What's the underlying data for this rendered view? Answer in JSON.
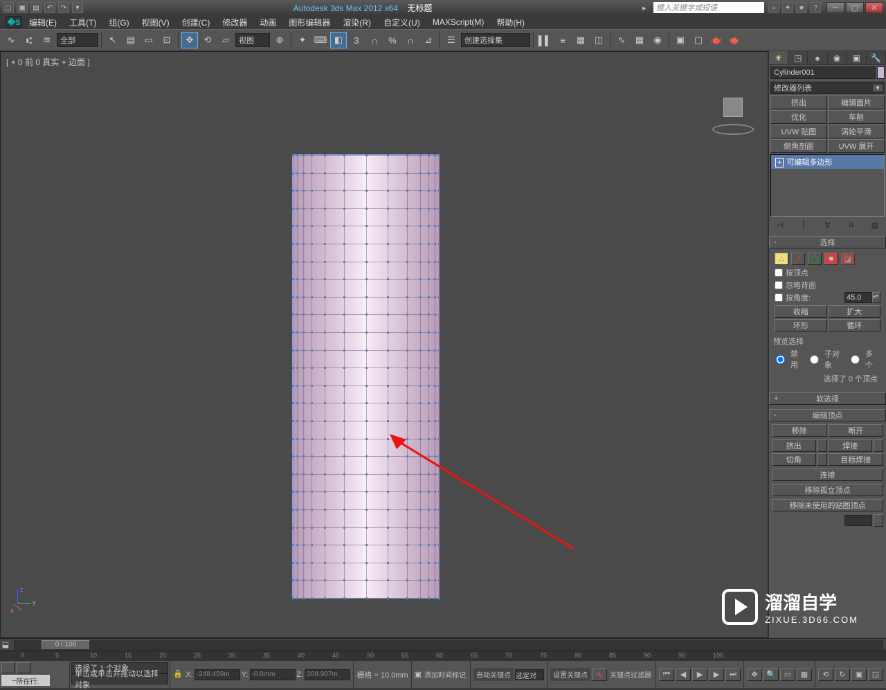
{
  "title": {
    "app": "Autodesk 3ds Max  2012 x64",
    "doc": "无标题"
  },
  "search_placeholder": "键入关键字或短语",
  "menu": [
    "编辑(E)",
    "工具(T)",
    "组(G)",
    "视图(V)",
    "创建(C)",
    "修改器",
    "动画",
    "图形编辑器",
    "渲染(R)",
    "自定义(U)",
    "MAXScript(M)",
    "帮助(H)"
  ],
  "toolbar": {
    "filter": "全部",
    "view": "视图",
    "angle": "3",
    "selset": "创建选择集"
  },
  "viewport_label": "[ + 0 前 0 真实 + 边面  ]",
  "sidepanel": {
    "obj_name": "Cylinder001",
    "modlist": "修改器列表",
    "modbtns": [
      "挤出",
      "编辑面片",
      "优化",
      "车削",
      "UVW 贴图",
      "涡轮平滑",
      "倒角剖面",
      "UVW 展开"
    ],
    "stack_item": "可编辑多边形",
    "r_select": "选择",
    "chk_by_vertex": "按顶点",
    "chk_ignore_back": "忽略背面",
    "chk_by_angle": "按角度:",
    "angle_val": "45.0",
    "shrink": "收缩",
    "grow": "扩大",
    "ring": "环形",
    "loop": "循环",
    "preview": "预览选择",
    "radio": [
      "禁用",
      "子对象",
      "多个"
    ],
    "sel_count": "选择了 0 个顶点",
    "r_soft": "软选择",
    "r_edit": "编辑顶点",
    "remove": "移除",
    "break": "断开",
    "extrude": "挤出",
    "weld": "焊接",
    "chamfer": "切角",
    "target": "目标焊接",
    "connect": "连接",
    "rem_iso": "移除孤立顶点",
    "rem_unused": "移除未使用的贴图顶点"
  },
  "timeline": {
    "pos": "0 / 100",
    "ticks": [
      0,
      5,
      10,
      15,
      20,
      25,
      30,
      35,
      40,
      45,
      50,
      55,
      60,
      65,
      70,
      75,
      80,
      85,
      90,
      95,
      100
    ]
  },
  "status": {
    "cur_row": "所在行:",
    "line1": "选择了 1 个对象",
    "line2": "单击或单击并拖动以选择对象",
    "x": "-248.459m",
    "y": "-0.0mm",
    "z": "209.907m",
    "grid": "栅格 = 10.0mm",
    "addtag": "添加时间标记",
    "autokey": "自动关键点",
    "setkey": "设置关键点",
    "keyfilter": "关键点过滤器",
    "selonly": "选定对"
  },
  "watermark": {
    "big": "溜溜自学",
    "sub": "ZIXUE.3D66.COM"
  }
}
